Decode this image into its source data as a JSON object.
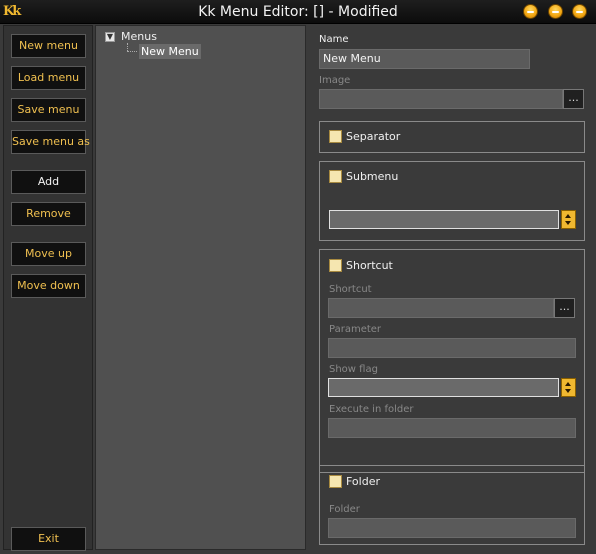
{
  "window": {
    "title": "Kk Menu Editor: [] - Modified",
    "logo": "Kk",
    "controls": [
      "minimize-icon",
      "maximize-icon",
      "close-icon"
    ],
    "accent_color": "#f0b830"
  },
  "toolbar": {
    "new_menu": "New menu",
    "load_menu": "Load menu",
    "save_menu": "Save menu",
    "save_menu_as": "Save menu as",
    "add": "Add",
    "remove": "Remove",
    "move_up": "Move up",
    "move_down": "Move down",
    "exit": "Exit"
  },
  "tree": {
    "root_label": "Menus",
    "expander_glyph": "▼",
    "children": [
      "New Menu"
    ]
  },
  "properties": {
    "name_label": "Name",
    "name_value": "New Menu",
    "image_label": "Image",
    "image_value": "",
    "browse": "...",
    "separator_label": "Separator",
    "submenu_label": "Submenu",
    "submenu_value": "",
    "shortcut_check_label": "Shortcut",
    "shortcut_field_label": "Shortcut",
    "shortcut_value": "",
    "parameter_label": "Parameter",
    "parameter_value": "",
    "show_flag_label": "Show flag",
    "show_flag_value": "",
    "execute_in_folder_label": "Execute in folder",
    "execute_in_folder_value": "",
    "folder_check_label": "Folder",
    "folder_field_label": "Folder",
    "folder_value": ""
  }
}
